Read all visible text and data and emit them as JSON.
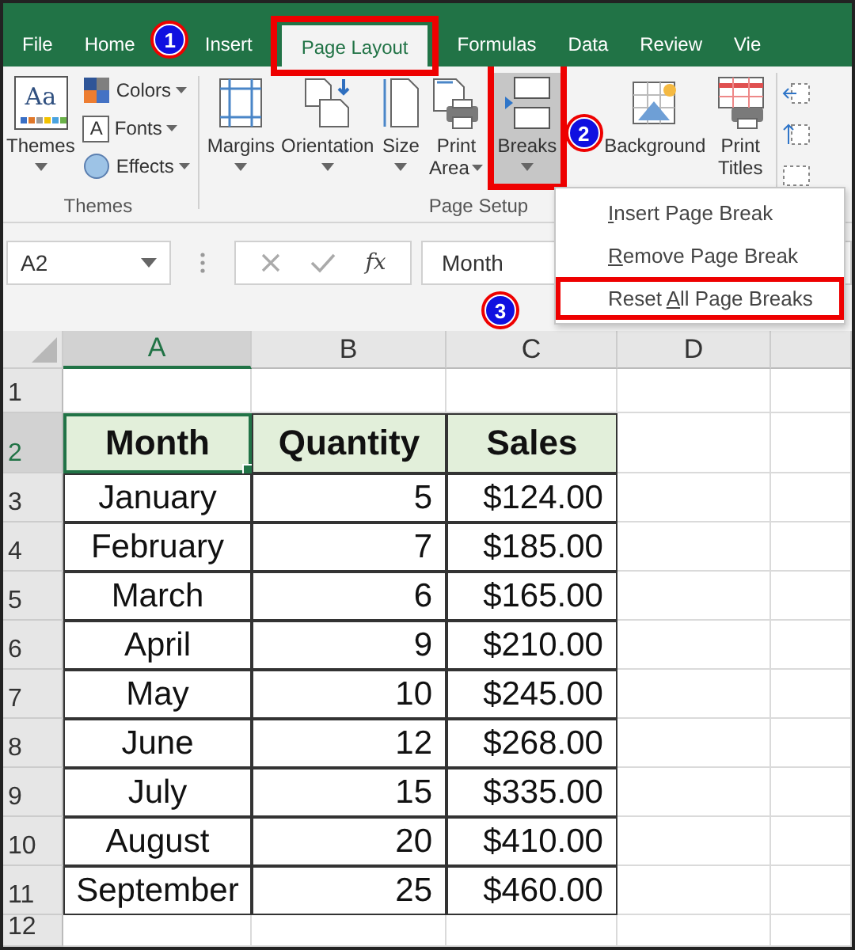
{
  "tabs": [
    {
      "label": "File",
      "selected": false,
      "highlighted": false
    },
    {
      "label": "Home",
      "selected": false,
      "highlighted": false
    },
    {
      "label": "Insert",
      "selected": false,
      "highlighted": false
    },
    {
      "label": "Page Layout",
      "selected": true,
      "highlighted": true
    },
    {
      "label": "Formulas",
      "selected": false,
      "highlighted": false
    },
    {
      "label": "Data",
      "selected": false,
      "highlighted": false
    },
    {
      "label": "Review",
      "selected": false,
      "highlighted": false
    },
    {
      "label": "Vie",
      "selected": false,
      "highlighted": false
    }
  ],
  "ribbon": {
    "groups": [
      {
        "label": "Themes",
        "large": [
          {
            "label": "Themes",
            "glyph": "Aa",
            "dropdown": true,
            "selected": false
          }
        ],
        "small": [
          {
            "label": "Colors",
            "dropdown": true
          },
          {
            "label": "Fonts",
            "glyph": "A",
            "dropdown": true
          },
          {
            "label": "Effects",
            "dropdown": true
          }
        ]
      },
      {
        "label": "Page Setup",
        "large": [
          {
            "label": "Margins",
            "dropdown": true,
            "selected": false,
            "highlighted": false
          },
          {
            "label": "Orientation",
            "dropdown": true,
            "selected": false,
            "highlighted": false
          },
          {
            "label": "Size",
            "dropdown": true,
            "selected": false,
            "highlighted": false
          },
          {
            "label": "Print Area",
            "dropdown": true,
            "selected": false,
            "highlighted": false
          },
          {
            "label": "Breaks",
            "dropdown": true,
            "selected": true,
            "highlighted": true
          },
          {
            "label": "Background",
            "dropdown": false,
            "selected": false,
            "highlighted": false
          },
          {
            "label": "Print Titles",
            "dropdown": false,
            "selected": false,
            "highlighted": false
          }
        ]
      }
    ]
  },
  "breaks_menu": {
    "items": [
      {
        "access_key": "I",
        "label_after_key": "nsert Page Break",
        "highlighted": false
      },
      {
        "access_key": "R",
        "label_after_key": "emove Page Break",
        "highlighted": false
      },
      {
        "label_before_key": "Reset ",
        "access_key": "A",
        "label_after_key": "ll Page Breaks",
        "highlighted": true
      }
    ]
  },
  "formula_bar": {
    "name_box": "A2",
    "function_label": "fx",
    "value": "Month"
  },
  "sheet": {
    "columns": [
      {
        "label": "A",
        "selected": true
      },
      {
        "label": "B",
        "selected": false
      },
      {
        "label": "C",
        "selected": false
      },
      {
        "label": "D",
        "selected": false
      }
    ],
    "rows": [
      {
        "label": "1",
        "selected": false,
        "kind": "empty"
      },
      {
        "label": "2",
        "selected": true,
        "kind": "header",
        "cells": [
          "Month",
          "Quantity",
          "Sales"
        ]
      },
      {
        "label": "3",
        "selected": false,
        "kind": "data",
        "cells": [
          "January",
          "5",
          "$124.00"
        ]
      },
      {
        "label": "4",
        "selected": false,
        "kind": "data",
        "cells": [
          "February",
          "7",
          "$185.00"
        ]
      },
      {
        "label": "5",
        "selected": false,
        "kind": "data",
        "cells": [
          "March",
          "6",
          "$165.00"
        ]
      },
      {
        "label": "6",
        "selected": false,
        "kind": "data",
        "cells": [
          "April",
          "9",
          "$210.00"
        ]
      },
      {
        "label": "7",
        "selected": false,
        "kind": "data",
        "cells": [
          "May",
          "10",
          "$245.00"
        ]
      },
      {
        "label": "8",
        "selected": false,
        "kind": "data",
        "cells": [
          "June",
          "12",
          "$268.00"
        ]
      },
      {
        "label": "9",
        "selected": false,
        "kind": "data",
        "cells": [
          "July",
          "15",
          "$335.00"
        ]
      },
      {
        "label": "10",
        "selected": false,
        "kind": "data",
        "cells": [
          "August",
          "20",
          "$410.00"
        ]
      },
      {
        "label": "11",
        "selected": false,
        "kind": "data",
        "cells": [
          "September",
          "25",
          "$460.00"
        ]
      },
      {
        "label": "12",
        "selected": false,
        "kind": "empty"
      }
    ]
  },
  "annotations": [
    {
      "number": "1"
    },
    {
      "number": "2"
    },
    {
      "number": "3"
    }
  ]
}
